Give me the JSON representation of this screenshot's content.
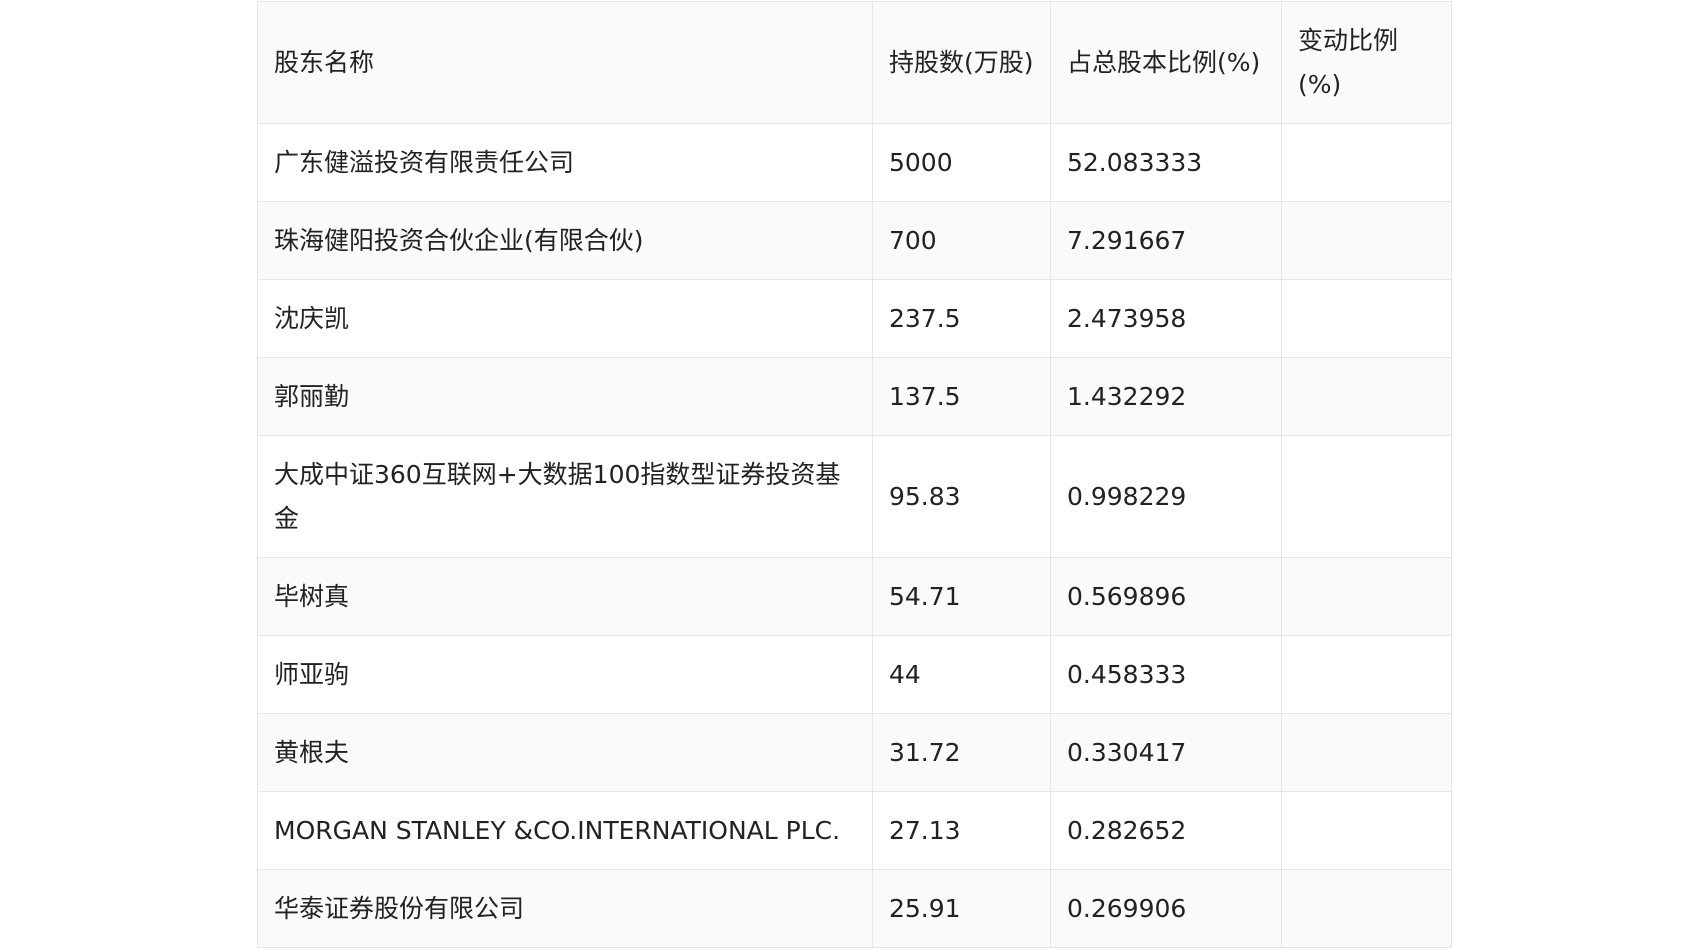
{
  "table": {
    "headers": [
      "股东名称",
      "持股数(万股)",
      "占总股本比例(%)",
      "变动比例(%)"
    ],
    "rows": [
      [
        "广东健溢投资有限责任公司",
        "5000",
        "52.083333",
        ""
      ],
      [
        "珠海健阳投资合伙企业(有限合伙)",
        "700",
        "7.291667",
        ""
      ],
      [
        "沈庆凯",
        "237.5",
        "2.473958",
        ""
      ],
      [
        "郭丽勤",
        "137.5",
        "1.432292",
        ""
      ],
      [
        "大成中证360互联网+大数据100指数型证券投资基金",
        "95.83",
        "0.998229",
        ""
      ],
      [
        "毕树真",
        "54.71",
        "0.569896",
        ""
      ],
      [
        "师亚驹",
        "44",
        "0.458333",
        ""
      ],
      [
        "黄根夫",
        "31.72",
        "0.330417",
        ""
      ],
      [
        "MORGAN STANLEY &CO.INTERNATIONAL PLC.",
        "27.13",
        "0.282652",
        ""
      ],
      [
        "华泰证券股份有限公司",
        "25.91",
        "0.269906",
        ""
      ]
    ]
  }
}
